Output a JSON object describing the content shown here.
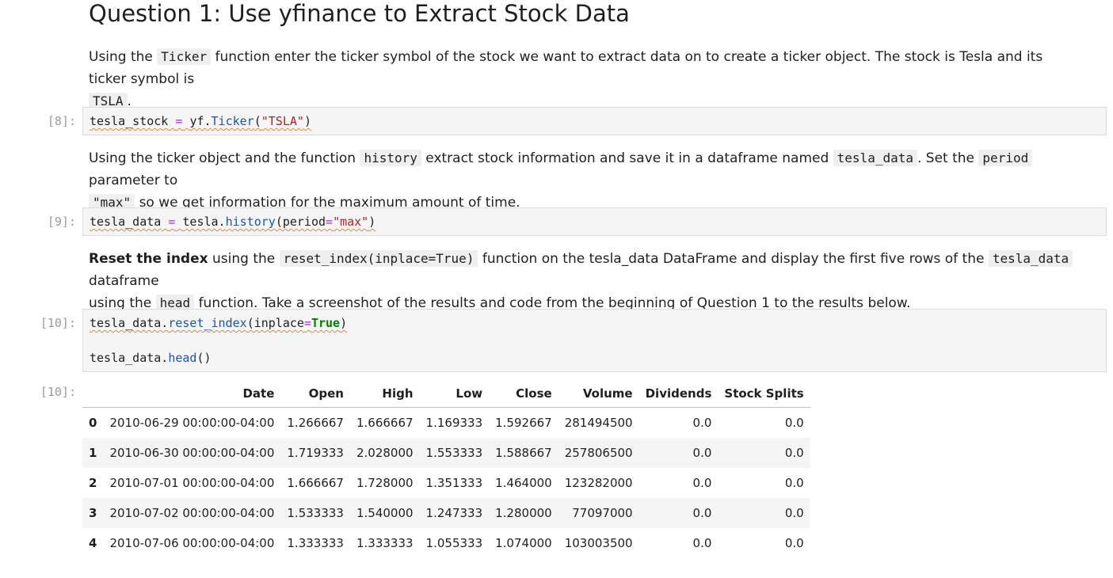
{
  "heading": "Question 1: Use yfinance to Extract Stock Data",
  "md1": {
    "t1": "Using the ",
    "c1": "Ticker",
    "t2": " function enter the ticker symbol of the stock we want to extract data on to create a ticker object. The stock is Tesla and its ticker symbol is",
    "c2": "TSLA",
    "t3": "."
  },
  "cell8": {
    "prompt": "[8]:",
    "var": "tesla_stock",
    "op": "=",
    "obj": "yf.",
    "fn": "Ticker",
    "open": "(",
    "str": "\"TSLA\"",
    "close": ")"
  },
  "md2": {
    "t1": "Using the ticker object and the function ",
    "c1": "history",
    "t2": " extract stock information and save it in a dataframe named ",
    "c2": "tesla_data",
    "t3": ". Set the ",
    "c3": "period",
    "t4": " parameter to",
    "c4": "\"max\"",
    "t5": " so we get information for the maximum amount of time."
  },
  "cell9": {
    "prompt": "[9]:",
    "var": "tesla_data",
    "op": "=",
    "obj": "tesla.",
    "fn": "history",
    "arg": "(period",
    "eq": "=",
    "str": "\"max\"",
    "close": ")"
  },
  "md3": {
    "b1": "Reset the index",
    "t1": " using the ",
    "c1": "reset_index(inplace=True)",
    "t2": " function on the tesla_data DataFrame and display the first five rows of the ",
    "c2": "tesla_data",
    "t3": " dataframe",
    "t4": "using the ",
    "c3": "head",
    "t5": " function. Take a screenshot of the results and code from the beginning of Question 1 to the results below."
  },
  "cell10": {
    "prompt": "[10]:",
    "l1_obj": "tesla_data.",
    "l1_fn": "reset_index",
    "l1_arg": "(inplace",
    "l1_eq": "=",
    "l1_bool": "True",
    "l1_close": ")",
    "l2_obj": "tesla_data.",
    "l2_fn": "head",
    "l2_close": "()"
  },
  "out10": {
    "prompt": "[10]:",
    "columns": [
      "",
      "Date",
      "Open",
      "High",
      "Low",
      "Close",
      "Volume",
      "Dividends",
      "Stock Splits"
    ],
    "rows": [
      [
        "0",
        "2010-06-29 00:00:00-04:00",
        "1.266667",
        "1.666667",
        "1.169333",
        "1.592667",
        "281494500",
        "0.0",
        "0.0"
      ],
      [
        "1",
        "2010-06-30 00:00:00-04:00",
        "1.719333",
        "2.028000",
        "1.553333",
        "1.588667",
        "257806500",
        "0.0",
        "0.0"
      ],
      [
        "2",
        "2010-07-01 00:00:00-04:00",
        "1.666667",
        "1.728000",
        "1.351333",
        "1.464000",
        "123282000",
        "0.0",
        "0.0"
      ],
      [
        "3",
        "2010-07-02 00:00:00-04:00",
        "1.533333",
        "1.540000",
        "1.247333",
        "1.280000",
        "77097000",
        "0.0",
        "0.0"
      ],
      [
        "4",
        "2010-07-06 00:00:00-04:00",
        "1.333333",
        "1.333333",
        "1.055333",
        "1.074000",
        "103003500",
        "0.0",
        "0.0"
      ]
    ]
  }
}
